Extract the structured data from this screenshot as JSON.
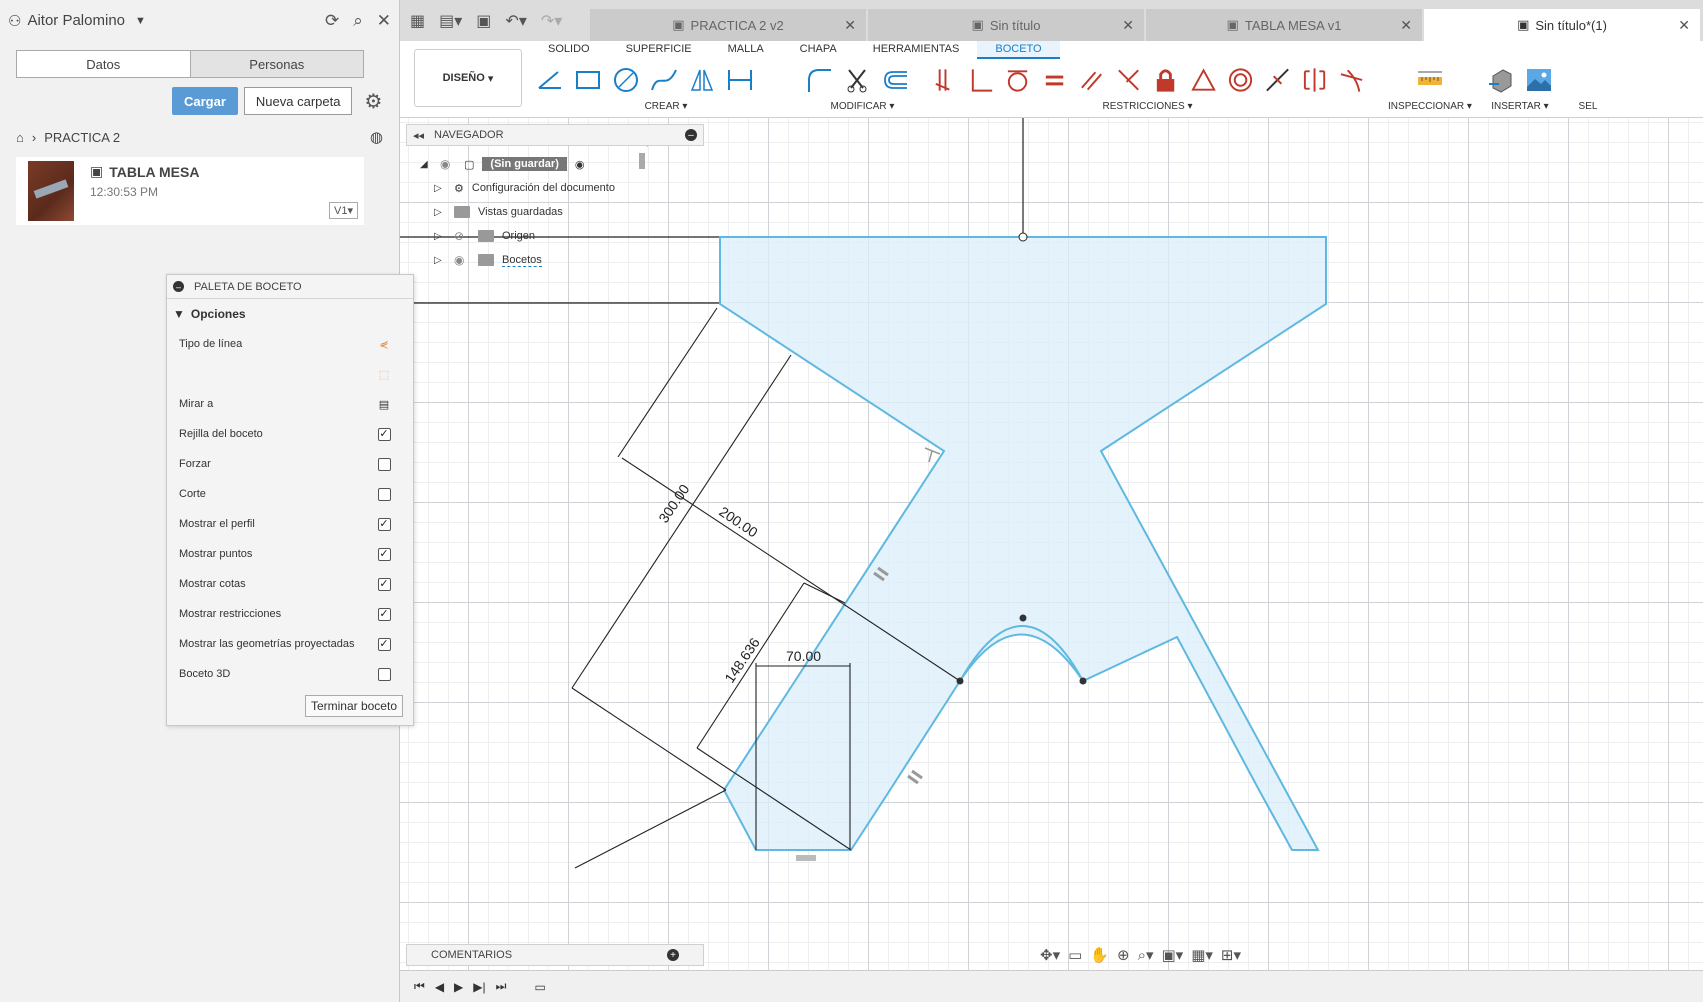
{
  "data_panel": {
    "user_name": "Aitor Palomino",
    "tabs": [
      "Datos",
      "Personas"
    ],
    "upload_label": "Cargar",
    "new_folder_label": "Nueva carpeta",
    "breadcrumb_project": "PRACTICA 2",
    "file": {
      "name": "TABLA MESA",
      "time": "12:30:53 PM",
      "version": "V1"
    }
  },
  "doc_tabs": [
    {
      "label": "PRACTICA 2 v2",
      "active": false
    },
    {
      "label": "Sin título",
      "active": false
    },
    {
      "label": "TABLA MESA v1",
      "active": false
    },
    {
      "label": "Sin título*(1)",
      "active": true
    }
  ],
  "ribbon": {
    "workspace": "DISEÑO",
    "tabs": [
      "SOLIDO",
      "SUPERFICIE",
      "MALLA",
      "CHAPA",
      "HERRAMIENTAS",
      "BOCETO"
    ],
    "active_tab": "BOCETO",
    "groups": [
      "CREAR",
      "MODIFICAR",
      "RESTRICCIONES",
      "INSPECCIONAR",
      "INSERTAR",
      "SEL"
    ]
  },
  "navigator": {
    "title": "NAVEGADOR",
    "root": "(Sin guardar)",
    "items": [
      "Configuración del documento",
      "Vistas guardadas",
      "Origen",
      "Bocetos"
    ]
  },
  "comments_label": "COMENTARIOS",
  "palette": {
    "title": "PALETA DE BOCETO",
    "section": "Opciones",
    "options": [
      {
        "label": "Tipo de línea",
        "type": "icon"
      },
      {
        "label": "",
        "type": "icon"
      },
      {
        "label": "Mirar a",
        "type": "icon"
      },
      {
        "label": "Rejilla del boceto",
        "type": "check",
        "checked": true
      },
      {
        "label": "Forzar",
        "type": "check",
        "checked": false
      },
      {
        "label": "Corte",
        "type": "check",
        "checked": false
      },
      {
        "label": "Mostrar el perfil",
        "type": "check",
        "checked": true
      },
      {
        "label": "Mostrar puntos",
        "type": "check",
        "checked": true
      },
      {
        "label": "Mostrar cotas",
        "type": "check",
        "checked": true
      },
      {
        "label": "Mostrar restricciones",
        "type": "check",
        "checked": true
      },
      {
        "label": "Mostrar las geometrías proyectadas",
        "type": "check",
        "checked": true
      },
      {
        "label": "Boceto 3D",
        "type": "check",
        "checked": false
      }
    ],
    "finish_label": "Terminar boceto"
  },
  "dimensions": {
    "d1": "300.00",
    "d2": "200.00",
    "d3": "148.636",
    "d4": "70.00"
  },
  "colors": {
    "accent": "#1a7fc9",
    "sketch_fill": "#dbeefb",
    "sketch_line": "#5fb8e0"
  }
}
